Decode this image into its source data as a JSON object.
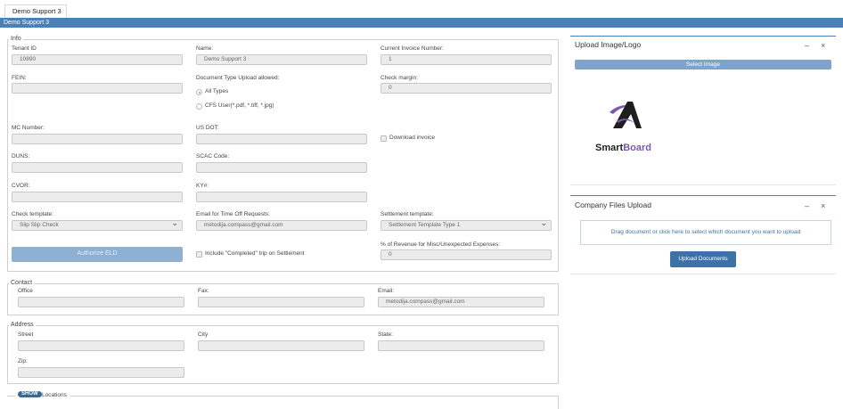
{
  "tab": {
    "label": "Demo Support 3"
  },
  "titlebar": {
    "text": "Demo Support 3"
  },
  "info": {
    "legend": "Info",
    "tenant_id": {
      "label": "Tenant ID",
      "value": "10890"
    },
    "name": {
      "label": "Name:",
      "value": "Demo Support 3"
    },
    "current_invoice": {
      "label": "Current Invoice Number:",
      "value": "1"
    },
    "fein": {
      "label": "FEIN:",
      "value": ""
    },
    "doc_type": {
      "label": "Document Type Upload allowed:",
      "options": [
        "All Types",
        "CFS User(*.pdf, *.tiff, *.jpg)"
      ],
      "selected": "All Types"
    },
    "check_margin": {
      "label": "Check margin:",
      "value": "0"
    },
    "mc_number": {
      "label": "MC Number:",
      "value": ""
    },
    "us_dot": {
      "label": "US DOT:",
      "value": ""
    },
    "download_invoice": {
      "label": "Download invoice"
    },
    "duns": {
      "label": "DUNS:",
      "value": ""
    },
    "scac_code": {
      "label": "SCAC Code:",
      "value": ""
    },
    "cvor": {
      "label": "CVOR:",
      "value": ""
    },
    "ky": {
      "label": "KY#:",
      "value": ""
    },
    "check_template": {
      "label": "Check template:",
      "value": "Slip Slip Check"
    },
    "email_time_off": {
      "label": "Email for Time Off Requests:",
      "value": "metodija.compass@gmail.com"
    },
    "settlement_template": {
      "label": "Settlement template:",
      "value": "Settlement Template Type 1"
    },
    "authorize_eld": {
      "label": "Authorize ELD"
    },
    "include_completed": {
      "label": "Include \"Completed\" trip on Settlement"
    },
    "revenue_pct": {
      "label": "% of Revenue for Misc/Unexpected Expenses:",
      "value": "0"
    }
  },
  "contact": {
    "legend": "Contact",
    "office": {
      "label": "Office",
      "value": ""
    },
    "fax": {
      "label": "Fax:",
      "value": ""
    },
    "email": {
      "label": "Email:",
      "value": "metodija.compass@gmail.com"
    }
  },
  "address": {
    "legend": "Address",
    "street": {
      "label": "Street",
      "value": ""
    },
    "city": {
      "label": "City",
      "value": ""
    },
    "state": {
      "label": "State:",
      "value": ""
    },
    "zip": {
      "label": "Zip:",
      "value": ""
    }
  },
  "locations": {
    "show_label": "SHOW",
    "label": "Locations"
  },
  "upload_logo": {
    "title": "Upload Image/Logo",
    "minimize": "–",
    "close": "×",
    "select_button": "Select Image",
    "logo_text_smart": "Smart",
    "logo_text_board": "Board"
  },
  "company_files": {
    "title": "Company Files Upload",
    "minimize": "–",
    "close": "×",
    "dropzone_text": "Drag document or click here to select which document you want to upload",
    "upload_button": "Upload Documents"
  },
  "colors": {
    "accent": "#4b80b6",
    "primary_button": "#3d72a8",
    "disabled_button": "#8eb0d3",
    "logo_purple": "#7a5aa6",
    "logo_dark": "#222222"
  }
}
